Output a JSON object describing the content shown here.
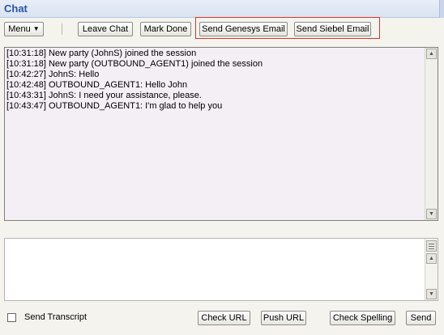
{
  "window": {
    "title": "Chat"
  },
  "toolbar": {
    "menu_label": "Menu",
    "leave_chat_label": "Leave Chat",
    "mark_done_label": "Mark Done",
    "send_genesys_email_label": "Send Genesys Email",
    "send_siebel_email_label": "Send Siebel Email"
  },
  "transcript": {
    "lines": [
      "[10:31:18] New party (JohnS) joined the session",
      "[10:31:18] New party (OUTBOUND_AGENT1) joined the session",
      "[10:42:27] JohnS: Hello",
      "[10:42:48] OUTBOUND_AGENT1: Hello John",
      "[10:43:31] JohnS: I need your assistance, please.",
      "[10:43:47] OUTBOUND_AGENT1: I'm glad to help you"
    ]
  },
  "compose": {
    "value": ""
  },
  "footer": {
    "send_transcript_label": "Send Transcript",
    "send_transcript_checked": false,
    "check_url_label": "Check URL",
    "push_url_label": "Push URL",
    "check_spelling_label": "Check Spelling",
    "send_label": "Send"
  },
  "colors": {
    "title": "#2b55a0",
    "highlight_border": "#d9342b"
  },
  "icons": {
    "menu_caret": "caret-down-icon",
    "scroll_up": "scroll-up-arrow-icon",
    "scroll_down": "scroll-down-arrow-icon"
  }
}
